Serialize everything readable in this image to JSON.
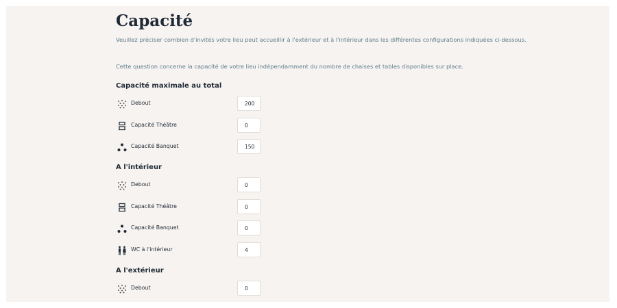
{
  "page": {
    "title": "Capacité",
    "description_1": "Veuillez préciser combien d'invités votre lieu peut accueillir à l'extérieur et à l'intérieur dans les différentes configurations indiquées ci-dessous.",
    "description_2": "Cette question concerne la capacité de votre lieu indépendamment du nombre de chaises et tables disponibles sur place."
  },
  "sections": [
    {
      "title": "Capacité maximale au total",
      "rows": [
        {
          "label": "Debout",
          "value": "200",
          "icon": "standing-dots-icon"
        },
        {
          "label": "Capacité Théâtre",
          "value": "0",
          "icon": "theatre-chair-icon"
        },
        {
          "label": "Capacité Banquet",
          "value": "150",
          "icon": "banquet-table-icon"
        }
      ]
    },
    {
      "title": "A l'intérieur",
      "rows": [
        {
          "label": "Debout",
          "value": "0",
          "icon": "standing-dots-icon"
        },
        {
          "label": "Capacité Théâtre",
          "value": "0",
          "icon": "theatre-chair-icon"
        },
        {
          "label": "Capacité Banquet",
          "value": "0",
          "icon": "banquet-table-icon"
        },
        {
          "label": "WC à l'intérieur",
          "value": "4",
          "icon": "restroom-icon"
        }
      ]
    },
    {
      "title": "A l'extérieur",
      "rows": [
        {
          "label": "Debout",
          "value": "0",
          "icon": "standing-dots-icon"
        }
      ]
    }
  ],
  "colors": {
    "panel_bg": "#f6f3f0",
    "heading": "#1f2a36",
    "description": "#5f7d8c",
    "input_border": "#e2ddd8"
  }
}
